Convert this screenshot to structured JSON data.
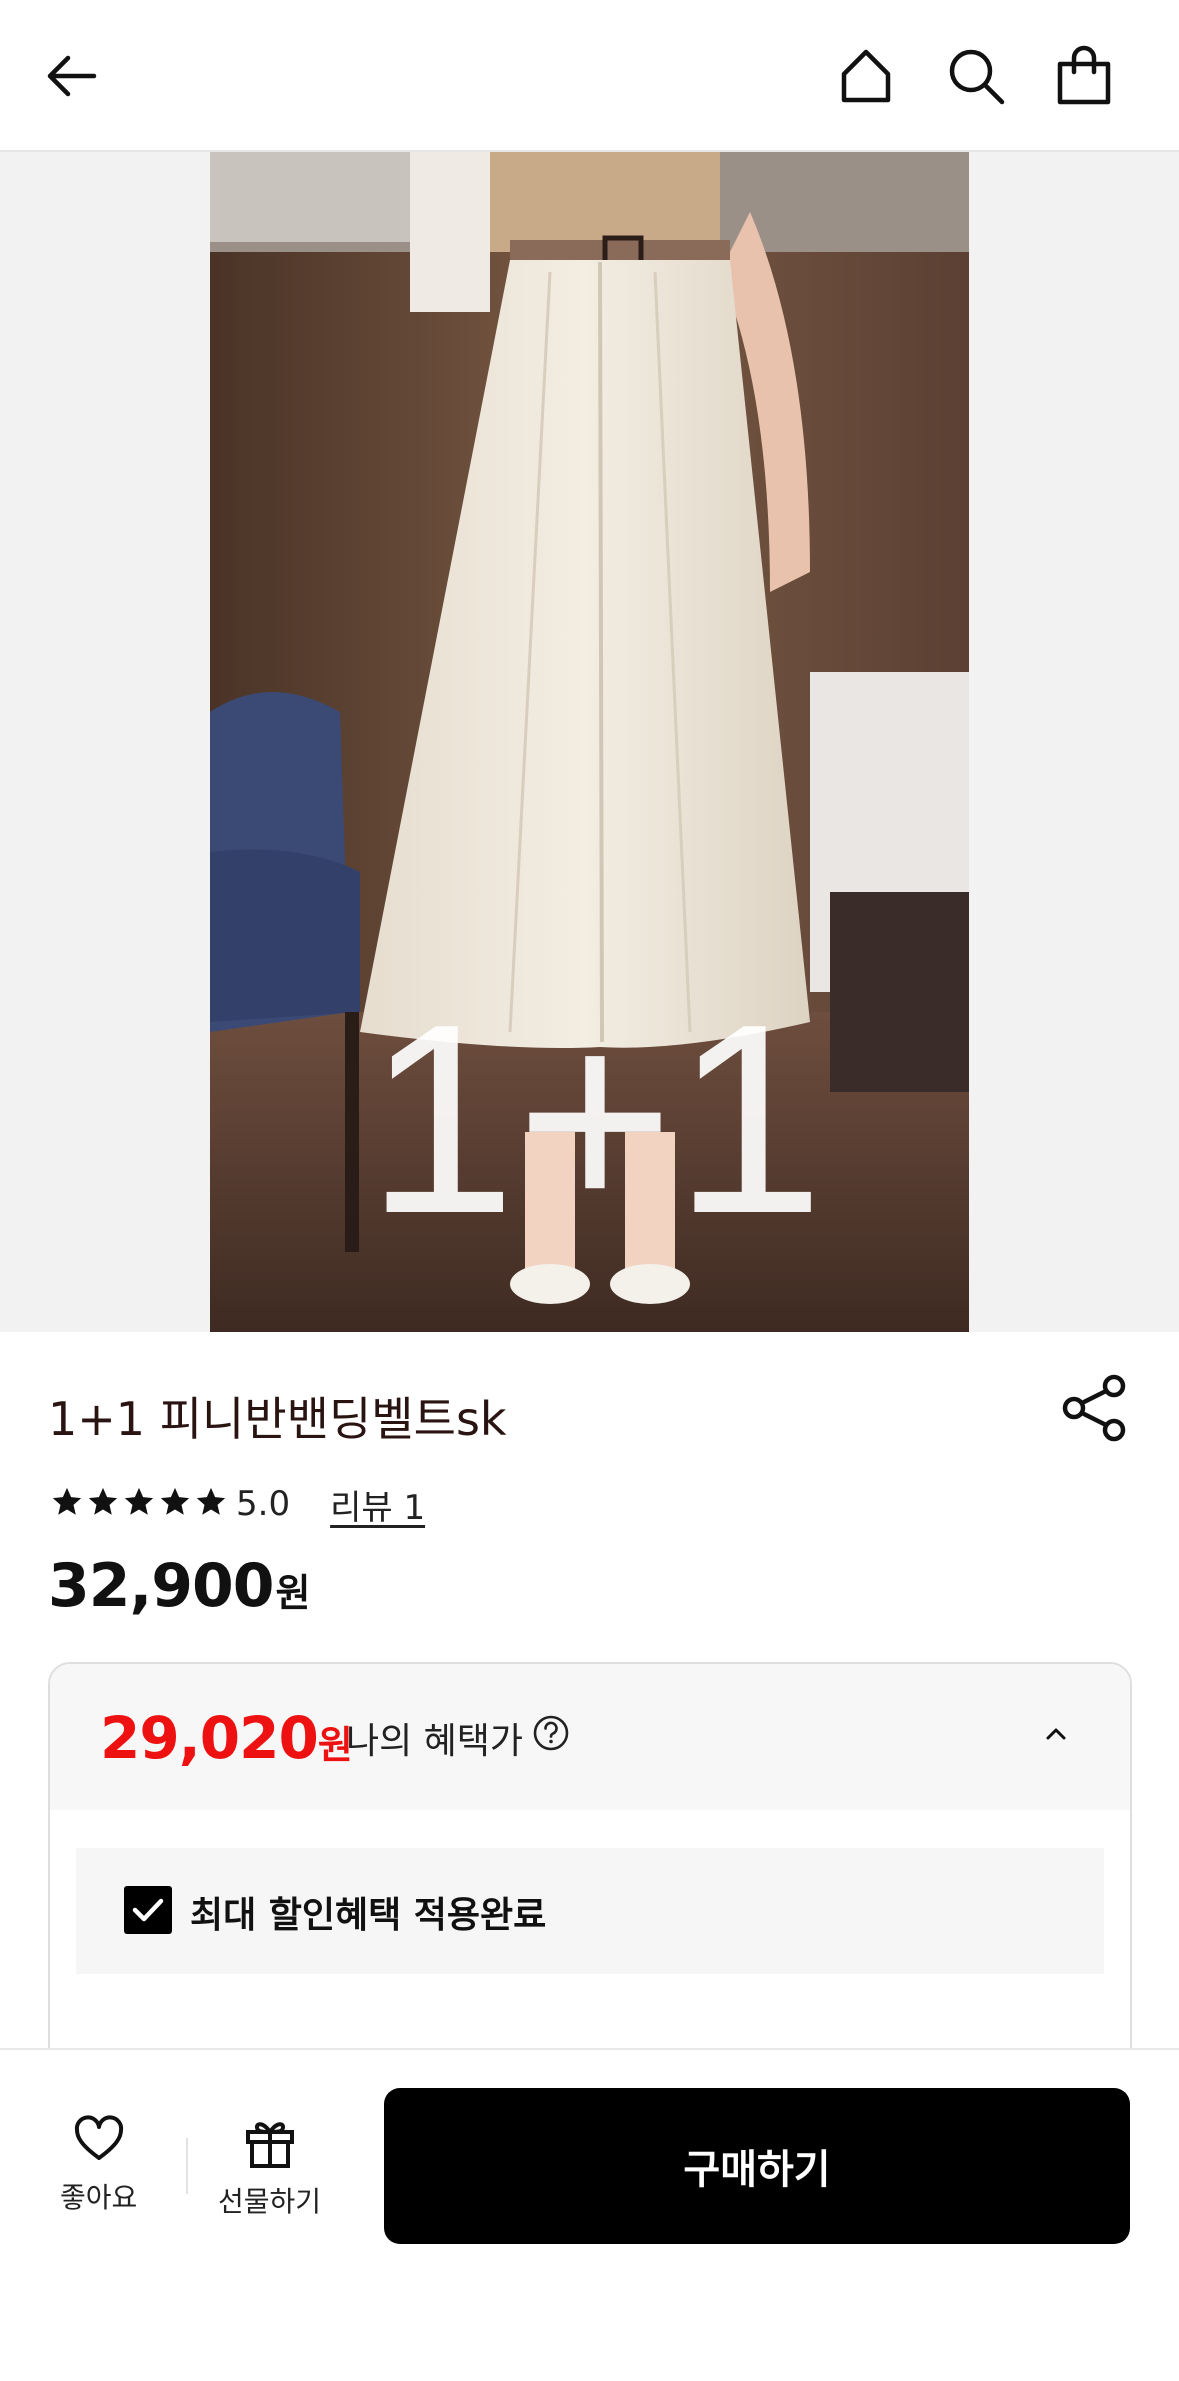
{
  "header": {
    "back_icon": "arrow-left-icon",
    "home_icon": "home-icon",
    "search_icon": "search-icon",
    "cart_icon": "shopping-bag-icon"
  },
  "hero": {
    "overlay_text": "1+1"
  },
  "product": {
    "title": "1+1 피니반밴딩벨트sk",
    "rating_stars": 5,
    "rating_score": "5.0",
    "review_link": "리뷰 1",
    "price": "32,900",
    "price_unit": "원"
  },
  "benefit": {
    "price": "29,020",
    "price_unit": "원",
    "label": "나의 혜택가",
    "applied_text": "최대 할인혜택 적용완료",
    "accent_color": "#ee1111"
  },
  "bottom_bar": {
    "like_label": "좋아요",
    "gift_label": "선물하기",
    "buy_label": "구매하기"
  }
}
